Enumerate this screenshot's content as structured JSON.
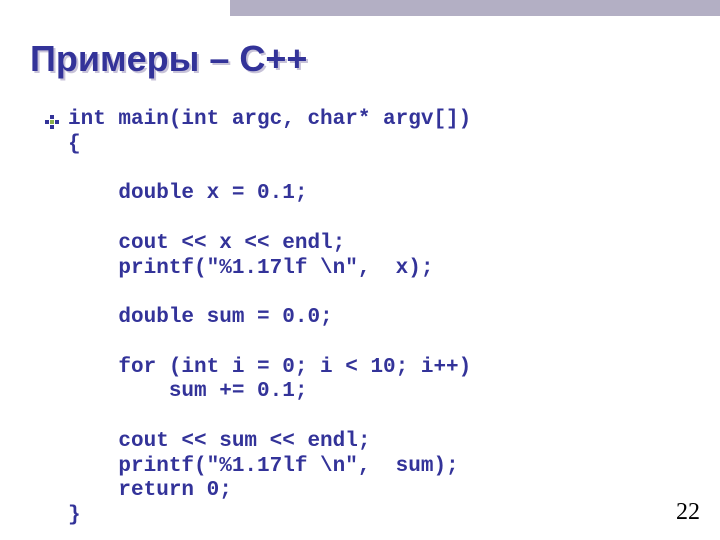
{
  "slide": {
    "title": "Примеры – С++",
    "code": "int main(int argc, char* argv[])\n{\n\n    double x = 0.1;\n\n    cout << x << endl;\n    printf(\"%1.17lf \\n\",  x);\n\n    double sum = 0.0;\n\n    for (int i = 0; i < 10; i++)\n        sum += 0.1;\n\n    cout << sum << endl;\n    printf(\"%1.17lf \\n\",  sum);\n    return 0;\n}",
    "page_number": "22"
  }
}
